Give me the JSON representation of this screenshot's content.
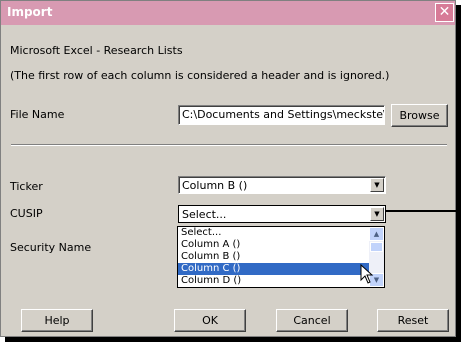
{
  "window": {
    "title": "Import"
  },
  "header": {
    "source": "Microsoft Excel - Research Lists",
    "note": "(The first row of each column is considered a header and is ignored.)"
  },
  "file": {
    "label": "File Name",
    "value": "C:\\Documents and Settings\\meckste\\Des",
    "browse_label": "Browse"
  },
  "ticker": {
    "label": "Ticker",
    "value": "Column B ()"
  },
  "cusip": {
    "label": "CUSIP",
    "value": "Select..."
  },
  "security_name": {
    "label": "Security Name"
  },
  "dropdown": {
    "options": [
      "Select...",
      "Column A ()",
      "Column B ()",
      "Column C ()",
      "Column D ()"
    ],
    "selected": "Column C ()"
  },
  "footer": {
    "help_label": "Help",
    "ok_label": "OK",
    "cancel_label": "Cancel",
    "reset_label": "Reset"
  },
  "colors": {
    "titlebar": "#d89ab2",
    "dialog_bg": "#d4d0c8",
    "selection": "#316ac5"
  }
}
